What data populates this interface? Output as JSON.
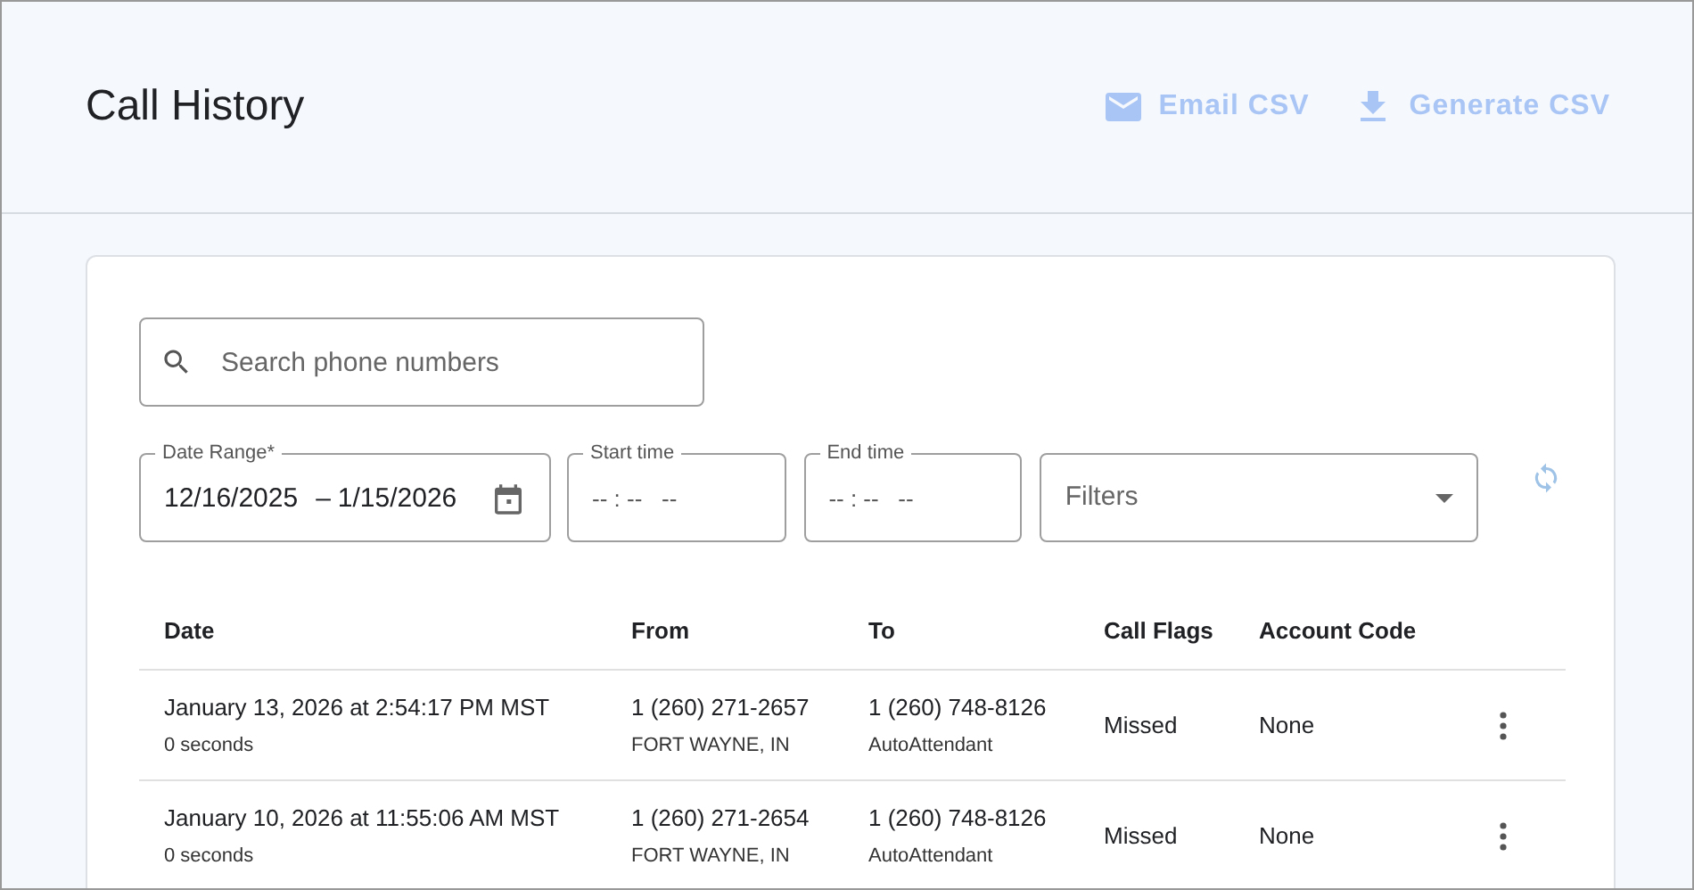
{
  "title": "Call History",
  "actions": [
    {
      "kind": "email",
      "label": "Email CSV",
      "disabled": true
    },
    {
      "kind": "download",
      "label": "Generate CSV",
      "disabled": true
    }
  ],
  "search": {
    "placeholder": "Search phone numbers"
  },
  "date_range": {
    "label": "Date Range*",
    "start": "12/16/2025",
    "separator": "–",
    "end": "1/15/2026"
  },
  "start_time": {
    "label": "Start time",
    "value": "-- : --   --"
  },
  "end_time": {
    "label": "End time",
    "value": "-- : --   --"
  },
  "filters": {
    "placeholder": "Filters"
  },
  "table": {
    "columns": [
      "Date",
      "From",
      "To",
      "Call Flags",
      "Account Code"
    ],
    "rows": [
      {
        "date": "January 13, 2026 at 2:54:17 PM MST",
        "duration": "0 seconds",
        "from": "1 (260) 271-2657",
        "from_location": "FORT WAYNE, IN",
        "to": "1 (260) 748-8126",
        "to_name": "AutoAttendant",
        "flags": "Missed",
        "account_code": "None"
      },
      {
        "date": "January 10, 2026 at 11:55:06 AM MST",
        "duration": "0 seconds",
        "from": "1 (260) 271-2654",
        "from_location": "FORT WAYNE, IN",
        "to": "1 (260) 748-8126",
        "to_name": "AutoAttendant",
        "flags": "Missed",
        "account_code": "None"
      }
    ]
  }
}
